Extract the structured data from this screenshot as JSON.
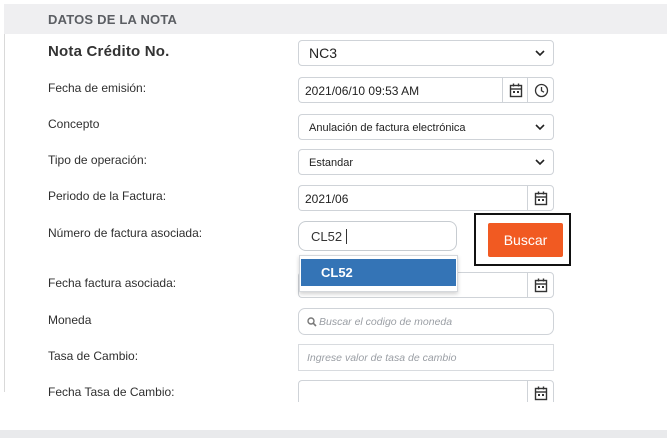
{
  "section": {
    "title": "DATOS DE LA NOTA"
  },
  "form": {
    "nota_credito": {
      "label": "Nota Crédito No.",
      "value": "NC3"
    },
    "fecha_emision": {
      "label": "Fecha de emisión:",
      "value": "2021/06/10 09:53 AM"
    },
    "concepto": {
      "label": "Concepto",
      "value": "Anulación de factura electrónica"
    },
    "tipo_operacion": {
      "label": "Tipo de operación:",
      "value": "Estandar"
    },
    "periodo_factura": {
      "label": "Periodo de la Factura:",
      "value": "2021/06"
    },
    "numero_factura": {
      "label": "Número de factura asociada:",
      "value": "CL52"
    },
    "fecha_factura": {
      "label": "Fecha factura asociada:",
      "value": ""
    },
    "moneda": {
      "label": "Moneda",
      "placeholder": "Buscar el codigo de moneda"
    },
    "tasa_cambio": {
      "label": "Tasa de Cambio:",
      "placeholder": "Ingrese valor de tasa de cambio"
    },
    "fecha_tasa": {
      "label": "Fecha Tasa de Cambio:",
      "value": ""
    }
  },
  "buttons": {
    "buscar": "Buscar"
  },
  "autocomplete": {
    "items": [
      "CL52"
    ]
  },
  "icons": {
    "calendar": "calendar-icon",
    "clock": "clock-icon",
    "chevron": "chevron-down-icon",
    "search": "search-icon"
  },
  "colors": {
    "accent": "#f15a22",
    "highlight": "#3474b6"
  }
}
